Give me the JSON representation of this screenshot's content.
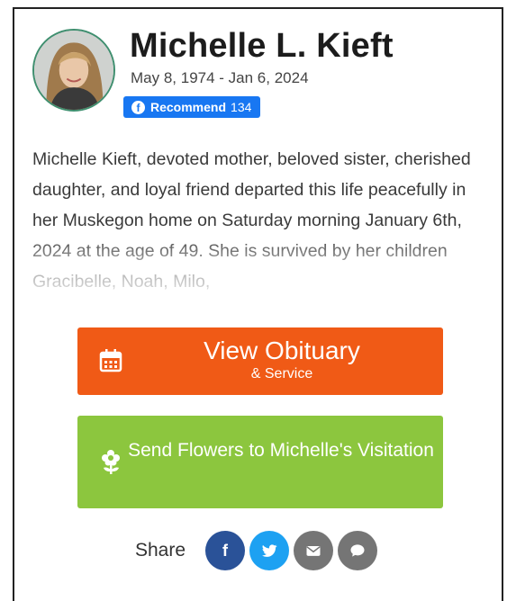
{
  "person": {
    "name": "Michelle L. Kieft",
    "dates": "May 8, 1974 - Jan 6, 2024"
  },
  "facebook": {
    "label": "Recommend",
    "count": "134"
  },
  "bio": "Michelle Kieft, devoted mother, beloved sister, cherished daughter, and loyal friend departed this life peacefully in her Muskegon home on Saturday morning January 6th, 2024 at the age of 49. She is survived by her children Gracibelle, Noah, Milo,",
  "buttons": {
    "obituary_label": "View Obituary",
    "obituary_sub": "& Service",
    "flowers_label": "Send Flowers to Michelle's Visitation"
  },
  "share": {
    "label": "Share",
    "items": [
      {
        "name": "facebook",
        "glyph": "f"
      },
      {
        "name": "twitter",
        "glyph": ""
      },
      {
        "name": "email",
        "glyph": ""
      },
      {
        "name": "sms",
        "glyph": ""
      }
    ]
  },
  "colors": {
    "obituary_button": "#f05a16",
    "flowers_button": "#8cc63e",
    "facebook_blue": "#1877f2",
    "share_facebook": "#2a5298",
    "share_twitter": "#1da1f2",
    "share_gray": "#757575"
  }
}
